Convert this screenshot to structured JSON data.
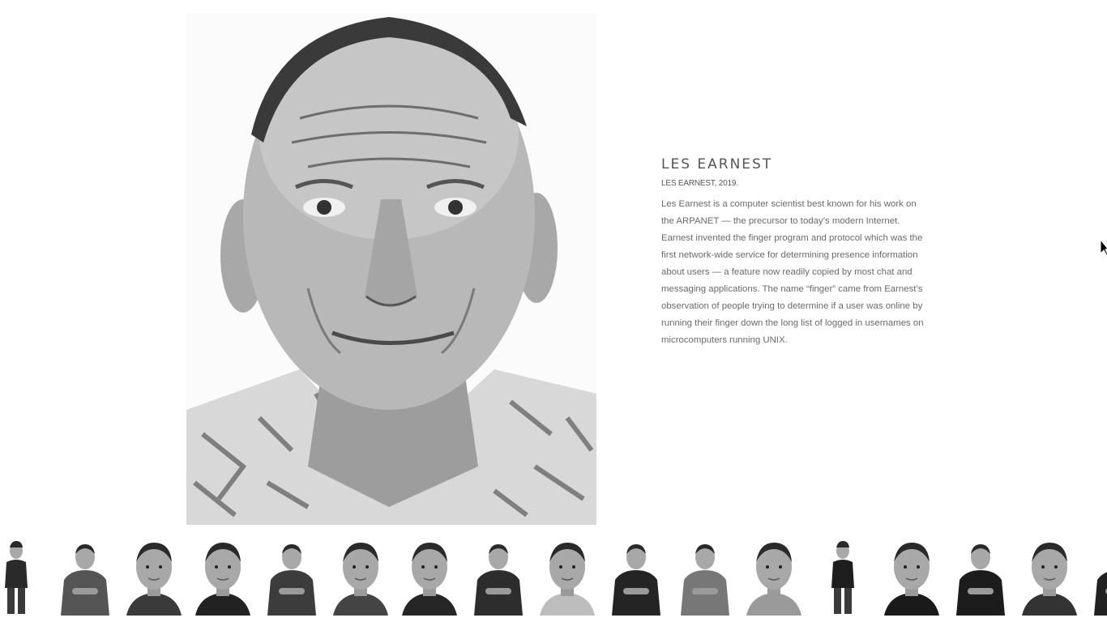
{
  "profile": {
    "name": "LES EARNEST",
    "caption": "LES EARNEST, 2019.",
    "bio": "Les Earnest is a computer scientist best known for his work on the ARPANET — the precursor to today’s modern Internet. Earnest invented the finger program and protocol which was the first network-wide service for determining presence information about users — a feature now readily copied by most chat and messaging applications. The name “finger” came from Earnest’s observation of people trying to determine if a user was online by running their finger down the long list of logged in usernames on microcomputers running UNIX."
  },
  "thumbnails": [
    {
      "pose": "full-body",
      "tone": "#2a2a2a"
    },
    {
      "pose": "half-body",
      "tone": "#555555"
    },
    {
      "pose": "headshot",
      "tone": "#3a3a3a"
    },
    {
      "pose": "headshot",
      "tone": "#222222"
    },
    {
      "pose": "half-body",
      "tone": "#3c3c3c"
    },
    {
      "pose": "headshot",
      "tone": "#444444"
    },
    {
      "pose": "headshot",
      "tone": "#262626"
    },
    {
      "pose": "half-body",
      "tone": "#2d2d2d"
    },
    {
      "pose": "headshot",
      "tone": "#bdbdbd"
    },
    {
      "pose": "half-body",
      "tone": "#242424"
    },
    {
      "pose": "half-body",
      "tone": "#777777"
    },
    {
      "pose": "headshot",
      "tone": "#9a9a9a"
    },
    {
      "pose": "full-body",
      "tone": "#1e1e1e"
    },
    {
      "pose": "headshot",
      "tone": "#1a1a1a"
    },
    {
      "pose": "half-body",
      "tone": "#1c1c1c"
    },
    {
      "pose": "headshot",
      "tone": "#333333"
    },
    {
      "pose": "half-body",
      "tone": "#222222"
    }
  ]
}
